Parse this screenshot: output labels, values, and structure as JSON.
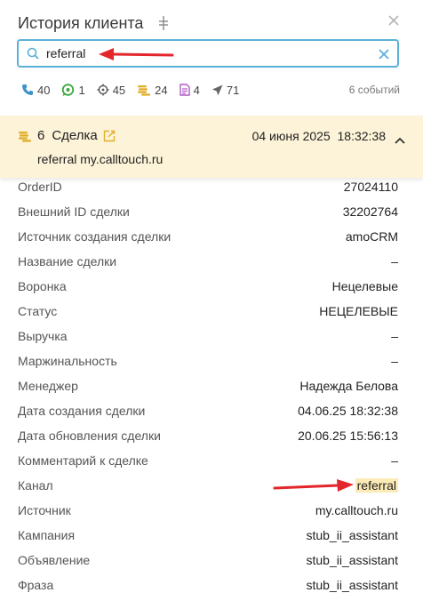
{
  "header": {
    "title": "История клиента"
  },
  "search": {
    "value": "referral",
    "placeholder": ""
  },
  "stats": [
    {
      "icon": "phone-icon",
      "count": "40"
    },
    {
      "icon": "chat-icon",
      "count": "1"
    },
    {
      "icon": "target-icon",
      "count": "45"
    },
    {
      "icon": "coins-icon",
      "count": "24"
    },
    {
      "icon": "document-icon",
      "count": "4"
    },
    {
      "icon": "send-icon",
      "count": "71"
    }
  ],
  "events_label": "6 событий",
  "deal": {
    "number": "6",
    "label": "Сделка",
    "date": "04 июня 2025  18:32:38",
    "source": "referral my.calltouch.ru"
  },
  "fields": [
    {
      "key": "OrderID",
      "value": "27024110"
    },
    {
      "key": "Внешний ID сделки",
      "value": "32202764"
    },
    {
      "key": "Источник создания сделки",
      "value": "amoCRM"
    },
    {
      "key": "Название сделки",
      "value": "–"
    },
    {
      "key": "Воронка",
      "value": "Нецелевые"
    },
    {
      "key": "Статус",
      "value": "НЕЦЕЛЕВЫЕ"
    },
    {
      "key": "Выручка",
      "value": "–"
    },
    {
      "key": "Маржинальность",
      "value": "–"
    },
    {
      "key": "Менеджер",
      "value": "Надежда Белова"
    },
    {
      "key": "Дата создания сделки",
      "value": "04.06.25 18:32:38"
    },
    {
      "key": "Дата обновления сделки",
      "value": "20.06.25 15:56:13"
    },
    {
      "key": "Комментарий к сделке",
      "value": "–"
    },
    {
      "key": "Канал",
      "value": "referral"
    },
    {
      "key": "Источник",
      "value": "my.calltouch.ru"
    },
    {
      "key": "Кампания",
      "value": "stub_ii_assistant"
    },
    {
      "key": "Объявление",
      "value": "stub_ii_assistant"
    },
    {
      "key": "Фраза",
      "value": "stub_ii_assistant"
    }
  ],
  "colors": {
    "accent": "#5bb0d8",
    "deal_bg": "#fdf3d8",
    "arrow": "#e3262b",
    "highlight": "#fcebb6"
  }
}
